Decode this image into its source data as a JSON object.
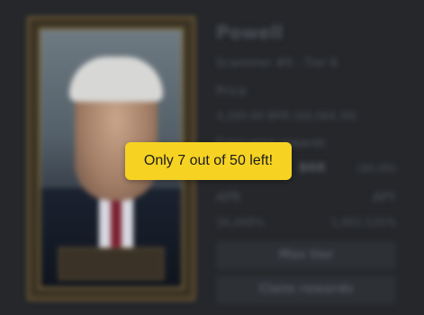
{
  "nft": {
    "name": "Powell",
    "subtitle": "Scammer #6 - Tier 6",
    "price_label": "Price",
    "price_value": "3,200.00 BRR ($9,064.39)",
    "estimated_rewards_label": "Estimated rewards",
    "estimated_rewards_brr": "BRR",
    "estimated_rewards_usd": "($0.00)",
    "apr_label": "APR",
    "apy_label": "APY",
    "apr_value": "16,449%",
    "apy_value": "1,002,535%"
  },
  "buttons": {
    "max_tier": "Max tier",
    "claim_rewards": "Claim rewards"
  },
  "toast": {
    "message": "Only 7 out of 50 left!"
  },
  "colors": {
    "background": "#25272b",
    "toast_bg": "#f6d322"
  }
}
